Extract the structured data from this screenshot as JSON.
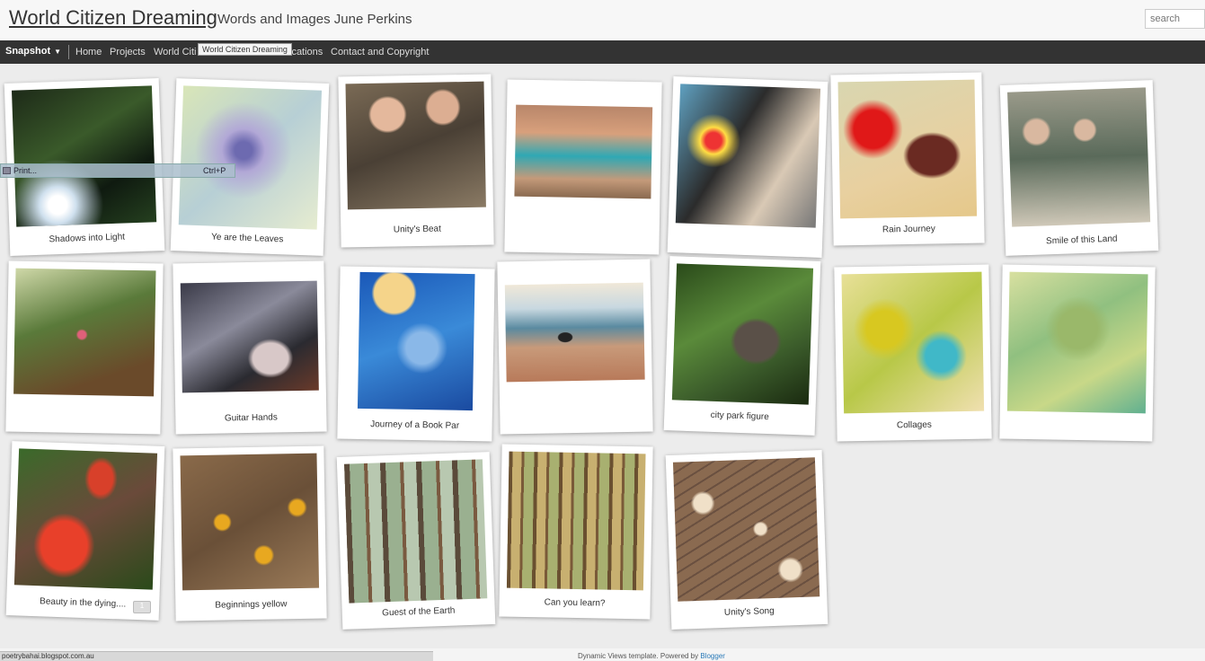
{
  "header": {
    "title": "World Citizen Dreaming",
    "description": "Words and Images June Perkins",
    "search_placeholder": "search"
  },
  "nav": {
    "view": "Snapshot",
    "links": [
      "Home",
      "Projects",
      "World Citi",
      "ications",
      "Contact and Copyright"
    ],
    "tooltip": "World Citizen Dreaming"
  },
  "print_menu": {
    "label": "Print...",
    "shortcut": "Ctrl+P"
  },
  "cards": [
    {
      "caption": "Shadows into Light"
    },
    {
      "caption": "Ye are the Leaves"
    },
    {
      "caption": "Unity's Beat"
    },
    {
      "caption": ""
    },
    {
      "caption": ""
    },
    {
      "caption": "Rain Journey"
    },
    {
      "caption": "Smile of this Land"
    },
    {
      "caption": ""
    },
    {
      "caption": "Guitar Hands"
    },
    {
      "caption": "Journey of a Book Par"
    },
    {
      "caption": ""
    },
    {
      "caption": "city park figure"
    },
    {
      "caption": "Collages"
    },
    {
      "caption": ""
    },
    {
      "caption": "Beauty in the dying...."
    },
    {
      "caption": "Beginnings yellow"
    },
    {
      "caption": "Guest of the Earth"
    },
    {
      "caption": "Can you learn?"
    },
    {
      "caption": "Unity's Song"
    }
  ],
  "comment_count": "1",
  "footer": {
    "status_url": "poetrybahai.blogspot.com.au",
    "template_text": "Dynamic Views template. Powered by ",
    "powered_link": "Blogger"
  }
}
